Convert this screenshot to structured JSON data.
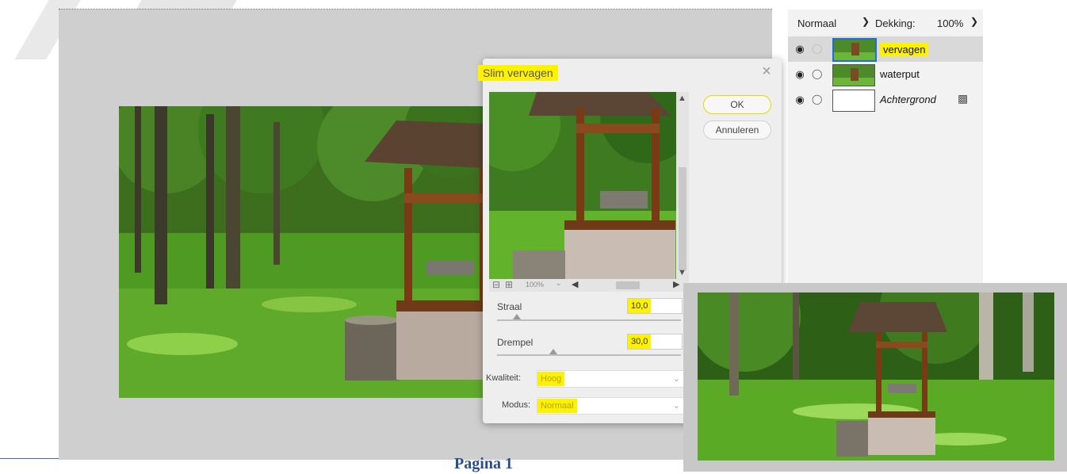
{
  "layers_panel": {
    "blend_mode": "Normaal",
    "opacity_label": "Dekking:",
    "opacity_value": "100%",
    "layers": [
      {
        "name": "vervagen",
        "selected": true
      },
      {
        "name": "waterput",
        "selected": false
      },
      {
        "name": "Achtergrond",
        "selected": false
      }
    ]
  },
  "dialog": {
    "title": "Slim vervagen",
    "ok_label": "OK",
    "cancel_label": "Annuleren",
    "zoom_level": "100%",
    "radius_label": "Straal",
    "radius_value": "10,0",
    "threshold_label": "Drempel",
    "threshold_value": "30,0",
    "quality_label": "Kwaliteit:",
    "quality_value": "Hoog",
    "mode_label": "Modus:",
    "mode_value": "Normaal"
  },
  "footer": {
    "page_label": "Pagina 1"
  },
  "colors": {
    "highlight": "#fff200",
    "selection": "#1e6fd0"
  }
}
